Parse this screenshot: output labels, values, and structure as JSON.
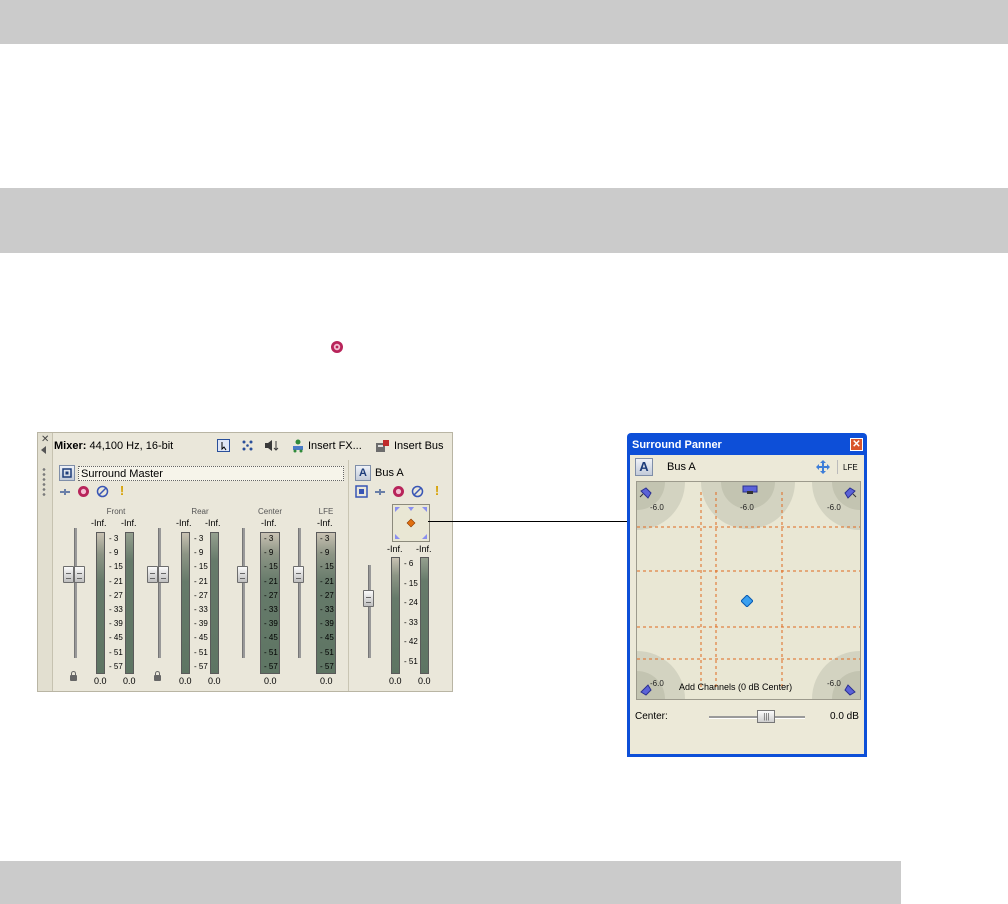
{
  "colors": {
    "band": "#cbcbcb",
    "window_title_blue": "#0d4fd8",
    "panel_bg": "#ece9d8",
    "guide_line": "#e06a1e",
    "diamond_blue": "#3aa0f0",
    "diamond_orange": "#e07010"
  },
  "inline_icon": "bus-fx-gear-icon",
  "mixer": {
    "title_bold": "Mixer:",
    "title_rest": " 44,100 Hz, 16-bit",
    "toolbar": {
      "insert_fx_label": "Insert FX...",
      "insert_bus_label": "Insert Bus"
    },
    "surround_master": {
      "name": "Surround Master",
      "channels": [
        {
          "label": "Front",
          "peak_left": "-Inf.",
          "peak_right": "-Inf.",
          "level_left": "0.0",
          "level_right": "0.0",
          "locked": true
        },
        {
          "label": "Rear",
          "peak_left": "-Inf.",
          "peak_right": "-Inf.",
          "level_left": "0.0",
          "level_right": "0.0",
          "locked": true
        },
        {
          "label": "Center",
          "peak": "-Inf.",
          "level": "0.0"
        },
        {
          "label": "LFE",
          "peak": "-Inf.",
          "level": "0.0"
        }
      ],
      "scale": [
        "3",
        "9",
        "15",
        "21",
        "27",
        "33",
        "39",
        "45",
        "51",
        "57"
      ]
    },
    "bus_a": {
      "badge": "A",
      "name": "Bus A",
      "peak_left": "-Inf.",
      "peak_right": "-Inf.",
      "level_left": "0.0",
      "level_right": "0.0",
      "scale": [
        "6",
        "15",
        "24",
        "33",
        "42",
        "51"
      ]
    }
  },
  "panner": {
    "title": "Surround Panner",
    "badge": "A",
    "bus_name": "Bus A",
    "lfe_label": "LFE",
    "speaker_db": [
      "-6.0",
      "-6.0",
      "-6.0",
      "-6.0",
      "-6.0"
    ],
    "mode_label": "Add Channels (0 dB Center)",
    "center_label": "Center:",
    "center_value": "0.0 dB",
    "center_slider_fraction": 0.62
  }
}
